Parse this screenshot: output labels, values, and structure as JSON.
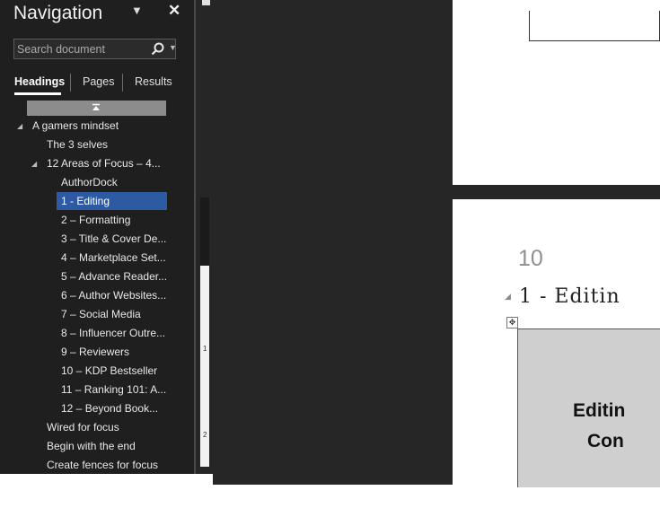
{
  "navigation": {
    "title": "Navigation",
    "search_placeholder": "Search document",
    "tabs": [
      {
        "label": "Headings",
        "active": true
      },
      {
        "label": "Pages",
        "active": false
      },
      {
        "label": "Results",
        "active": false
      }
    ],
    "tree": [
      {
        "label": "A gamers mindset",
        "level": 1,
        "expanded": true
      },
      {
        "label": "The 3 selves",
        "level": 2
      },
      {
        "label": "12 Areas of Focus – 4...",
        "level": 2,
        "expanded": true
      },
      {
        "label": "AuthorDock",
        "level": 3
      },
      {
        "label": "1 - Editing",
        "level": 3,
        "selected": true
      },
      {
        "label": "2 – Formatting",
        "level": 3
      },
      {
        "label": "3 – Title & Cover De...",
        "level": 3
      },
      {
        "label": "4 – Marketplace Set...",
        "level": 3
      },
      {
        "label": "5 – Advance Reader...",
        "level": 3
      },
      {
        "label": "6 – Author Websites...",
        "level": 3
      },
      {
        "label": "7 – Social Media",
        "level": 3
      },
      {
        "label": "8 – Influencer Outre...",
        "level": 3
      },
      {
        "label": "9 – Reviewers",
        "level": 3
      },
      {
        "label": "10 – KDP Bestseller",
        "level": 3
      },
      {
        "label": "11 – Ranking 101: A...",
        "level": 3
      },
      {
        "label": "12 – Beyond Book...",
        "level": 3
      },
      {
        "label": "Wired for focus",
        "level": 2
      },
      {
        "label": "Begin with the end",
        "level": 2
      },
      {
        "label": "Create fences for focus",
        "level": 2
      }
    ]
  },
  "ruler": {
    "marks": [
      "1",
      "2"
    ]
  },
  "document": {
    "page_number": "10",
    "heading": "1 - Editin",
    "box_line1": "Editin",
    "box_line2": "Con"
  },
  "colors": {
    "panel_bg": "#1f1f1f",
    "selection": "#2e5aa3",
    "canvas_bg": "#262626"
  }
}
